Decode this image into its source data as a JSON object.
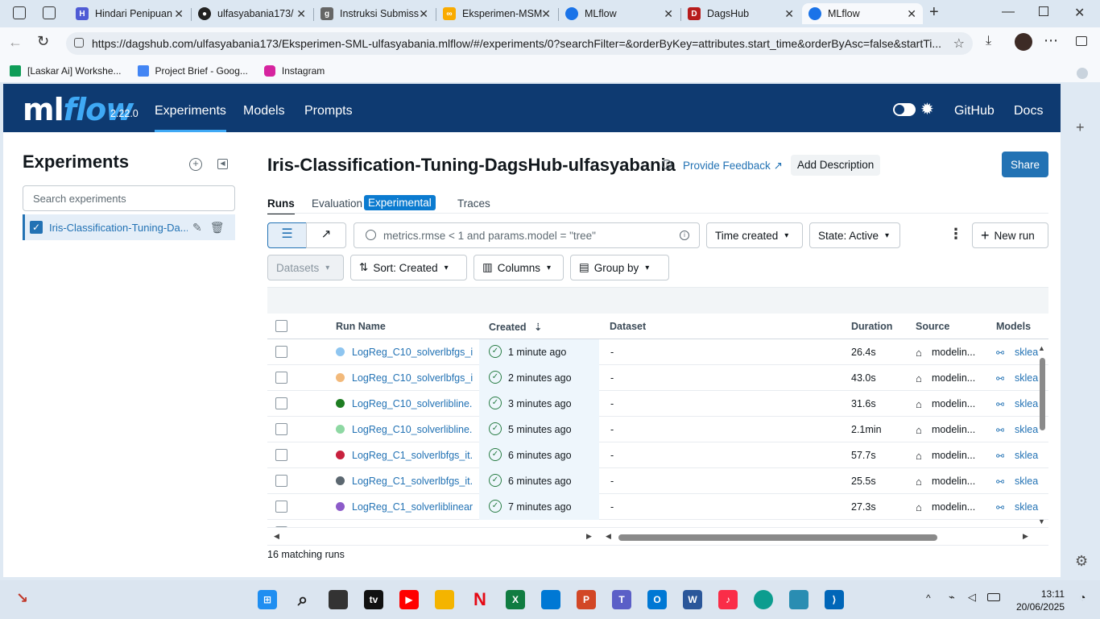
{
  "browser": {
    "tabs": [
      {
        "title": "Hindari Penipuan"
      },
      {
        "title": "ulfasyabania173/"
      },
      {
        "title": "Instruksi Submiss"
      },
      {
        "title": "Eksperimen-MSM"
      },
      {
        "title": "MLflow"
      },
      {
        "title": "DagsHub"
      },
      {
        "title": "MLflow"
      }
    ],
    "url": "https://dagshub.com/ulfasyabania173/Eksperimen-SML-ulfasyabania.mlflow/#/experiments/0?searchFilter=&orderByKey=attributes.start_time&orderByAsc=false&startTi...",
    "bookmarks": [
      "[Laskar Ai] Workshe...",
      "Project Brief - Goog...",
      "Instagram"
    ]
  },
  "header": {
    "logo_ml": "ml",
    "logo_flow": "flow",
    "version": "2.22.0",
    "nav": [
      "Experiments",
      "Models",
      "Prompts"
    ],
    "github": "GitHub",
    "docs": "Docs"
  },
  "sidebar": {
    "title": "Experiments",
    "search_placeholder": "Search experiments",
    "experiment": "Iris-Classification-Tuning-Da..."
  },
  "main": {
    "title": "Iris-Classification-Tuning-DagsHub-ulfasyabania",
    "feedback": "Provide Feedback",
    "add_description": "Add Description",
    "share": "Share",
    "tabs": [
      "Runs",
      "Evaluation",
      "Experimental",
      "Traces"
    ],
    "search_placeholder": "metrics.rmse < 1 and params.model = \"tree\"",
    "time_created": "Time created",
    "state": "State: Active",
    "new_run": "New run",
    "datasets": "Datasets",
    "sort": "Sort: Created",
    "columns": "Columns",
    "group_by": "Group by",
    "matching": "16 matching runs"
  },
  "table": {
    "headers": [
      "Run Name",
      "Created",
      "Dataset",
      "Duration",
      "Source",
      "Models"
    ],
    "rows": [
      {
        "name": "LogReg_C10_solverlbfgs_i...",
        "color": "#8ec5f0",
        "created": "1 minute ago",
        "dataset": "-",
        "duration": "26.4s",
        "source": "modelin...",
        "model": "sklea"
      },
      {
        "name": "LogReg_C10_solverlbfgs_i...",
        "color": "#f2b97a",
        "created": "2 minutes ago",
        "dataset": "-",
        "duration": "43.0s",
        "source": "modelin...",
        "model": "sklea"
      },
      {
        "name": "LogReg_C10_solverlibline...",
        "color": "#1e7d22",
        "created": "3 minutes ago",
        "dataset": "-",
        "duration": "31.6s",
        "source": "modelin...",
        "model": "sklea"
      },
      {
        "name": "LogReg_C10_solverlibline...",
        "color": "#8ed8a3",
        "created": "5 minutes ago",
        "dataset": "-",
        "duration": "2.1min",
        "source": "modelin...",
        "model": "sklea"
      },
      {
        "name": "LogReg_C1_solverlbfgs_it...",
        "color": "#c8213e",
        "created": "6 minutes ago",
        "dataset": "-",
        "duration": "57.7s",
        "source": "modelin...",
        "model": "sklea"
      },
      {
        "name": "LogReg_C1_solverlbfgs_it...",
        "color": "#5b6770",
        "created": "6 minutes ago",
        "dataset": "-",
        "duration": "25.5s",
        "source": "modelin...",
        "model": "sklea"
      },
      {
        "name": "LogReg_C1_solverliblinear...",
        "color": "#8c5bc9",
        "created": "7 minutes ago",
        "dataset": "-",
        "duration": "27.3s",
        "source": "modelin...",
        "model": "sklea"
      }
    ]
  },
  "system": {
    "time": "13:11",
    "date": "20/06/2025"
  }
}
